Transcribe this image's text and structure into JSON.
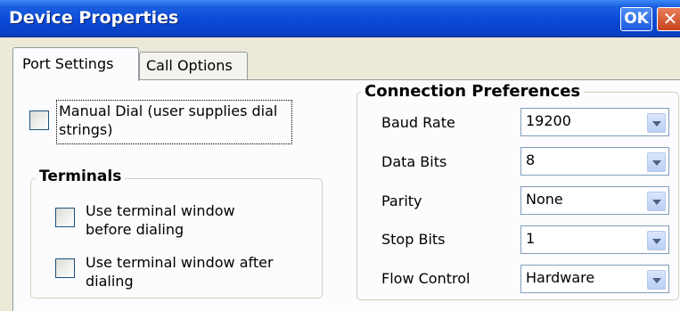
{
  "window": {
    "title": "Device Properties",
    "ok_label": "OK",
    "close_label": "✕"
  },
  "tabs": [
    {
      "label": "Port Settings",
      "active": true
    },
    {
      "label": "Call Options",
      "active": false
    }
  ],
  "manual_dial": {
    "label_line1": "Manual Dial (user supplies dial",
    "label_line2": "strings)",
    "checked": false
  },
  "terminals": {
    "title": "Terminals",
    "before_dialing": {
      "line1": "Use terminal window",
      "line2": "before dialing",
      "checked": false
    },
    "after_dialing": {
      "line1": "Use terminal window after",
      "line2": "dialing",
      "checked": false
    }
  },
  "connection_preferences": {
    "title": "Connection Preferences",
    "baud_rate": {
      "label": "Baud Rate",
      "value": "19200"
    },
    "data_bits": {
      "label": "Data Bits",
      "value": "8"
    },
    "parity": {
      "label": "Parity",
      "value": "None"
    },
    "stop_bits": {
      "label": "Stop Bits",
      "value": "1"
    },
    "flow_control": {
      "label": "Flow Control",
      "value": "Hardware"
    }
  },
  "icons": {
    "dropdown": "chevron-down-icon"
  },
  "colors": {
    "titlebar": "#0a4ad6",
    "dialog_bg": "#ece9d8",
    "panel_bg": "#fcfcfe",
    "close_button": "#c8431d"
  }
}
